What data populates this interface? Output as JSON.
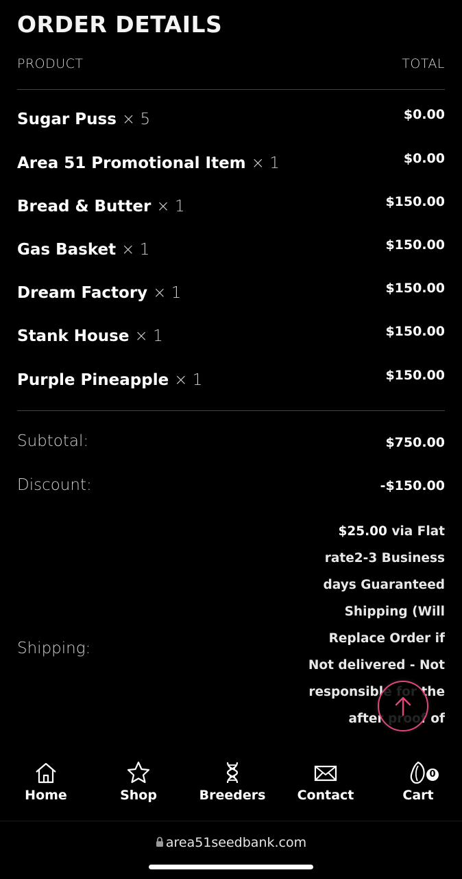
{
  "page": {
    "title": "ORDER DETAILS"
  },
  "table": {
    "product_header": "PRODUCT",
    "total_header": "TOTAL"
  },
  "items": [
    {
      "name": "Sugar Puss",
      "qty": "× 5",
      "price": "$0.00"
    },
    {
      "name": "Area 51 Promotional Item",
      "qty": "× 1",
      "price": "$0.00"
    },
    {
      "name": "Bread & Butter",
      "qty": "× 1",
      "price": "$150.00"
    },
    {
      "name": "Gas Basket",
      "qty": "× 1",
      "price": "$150.00"
    },
    {
      "name": "Dream Factory",
      "qty": "× 1",
      "price": "$150.00"
    },
    {
      "name": "Stank House",
      "qty": "× 1",
      "price": "$150.00"
    },
    {
      "name": "Purple Pineapple",
      "qty": "× 1",
      "price": "$150.00"
    }
  ],
  "totals": {
    "subtotal_label": "Subtotal:",
    "subtotal_value": "$750.00",
    "discount_label": "Discount:",
    "discount_value": "-$150.00",
    "shipping_label": "Shipping:",
    "shipping_amount": "$25.00",
    "shipping_desc": "via Flat rate2-3 Business days Guaranteed Shipping (Will Replace Order if Not delivered - Not responsible for the after proof of"
  },
  "nav": {
    "home": "Home",
    "shop": "Shop",
    "breeders": "Breeders",
    "contact": "Contact",
    "cart": "Cart",
    "cart_count": "0"
  },
  "browser": {
    "url": "area51seedbank.com"
  },
  "colors": {
    "accent": "#e0457b",
    "background": "#000000"
  }
}
